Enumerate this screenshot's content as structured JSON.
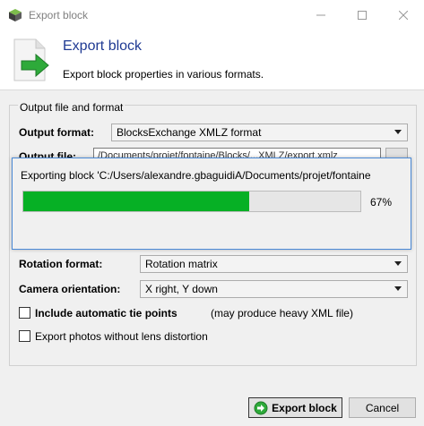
{
  "window": {
    "title": "Export block"
  },
  "header": {
    "title": "Export block",
    "description": "Export block properties in various formats."
  },
  "group": {
    "title": "Output file and format"
  },
  "output_format": {
    "label": "Output format:",
    "value": "BlocksExchange XMLZ format"
  },
  "output_file": {
    "label": "Output file:",
    "value": "/Documents/projet/fontaine/Blocks/...XMLZ/export.xmlz"
  },
  "progress": {
    "text": "Exporting block 'C:/Users/alexandre.gbaguidiA/Documents/projet/fontaine",
    "percent": 67,
    "percent_label": "67%",
    "color": "#06b025"
  },
  "rotation_format": {
    "label": "Rotation format:",
    "value": "Rotation matrix"
  },
  "camera_orientation": {
    "label": "Camera orientation:",
    "value": "X right, Y down"
  },
  "tie_points": {
    "label": "Include automatic tie points",
    "note": "(may produce heavy XML file)"
  },
  "photos": {
    "label": "Export photos without lens distortion"
  },
  "buttons": {
    "export": "Export block",
    "cancel": "Cancel"
  },
  "colors": {
    "accent": "#1f3a93",
    "focus_border": "#4a89d6"
  }
}
